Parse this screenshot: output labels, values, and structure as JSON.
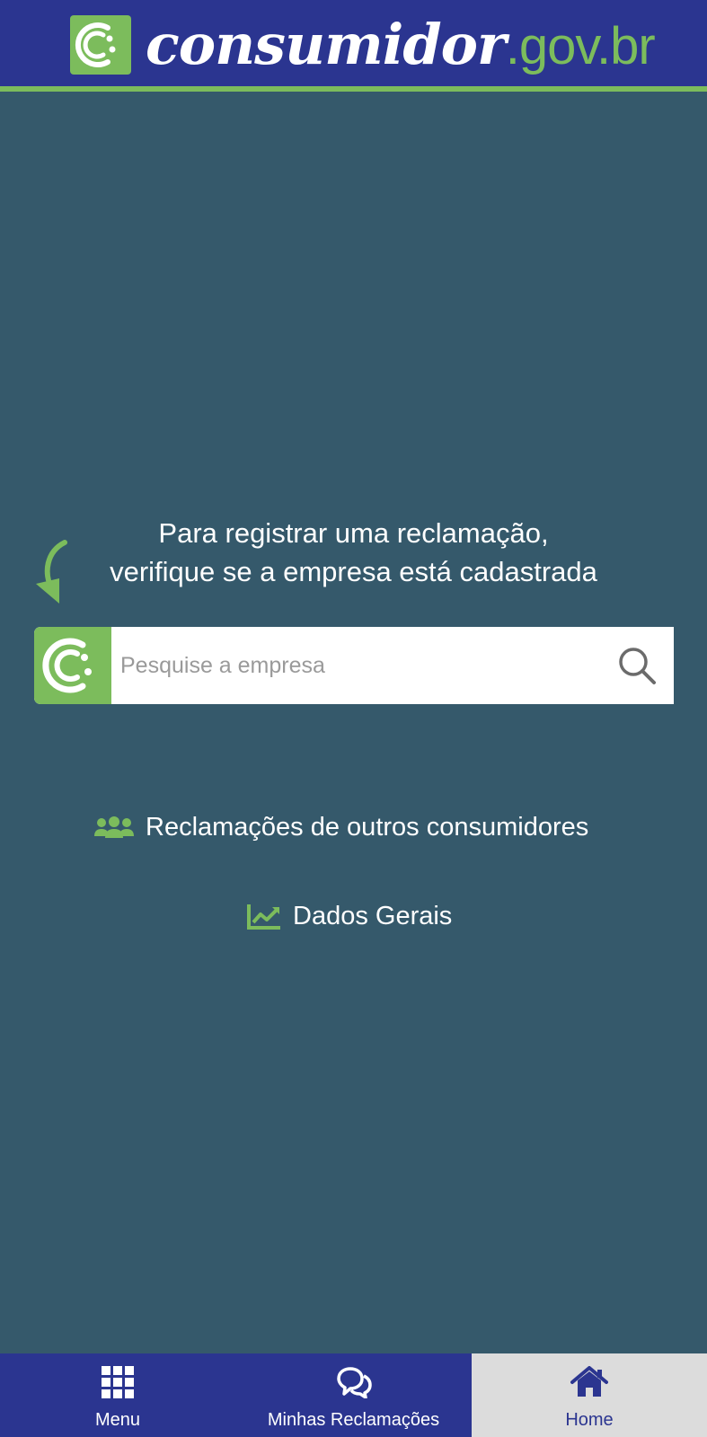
{
  "header": {
    "brand_main": "consumidor",
    "brand_suffix": ".gov.br"
  },
  "main": {
    "prompt_line1": "Para registrar uma reclamação,",
    "prompt_line2": "verifique se a empresa está cadastrada",
    "search_placeholder": "Pesquise a empresa",
    "links": {
      "others_label": "Reclamações de outros consumidores",
      "dados_label": "Dados Gerais"
    }
  },
  "bottom_nav": {
    "menu_label": "Menu",
    "reclamacoes_label": "Minhas Reclamações",
    "home_label": "Home",
    "active": "Home"
  },
  "colors": {
    "header_bg": "#2b3590",
    "accent_green": "#7cbc5c",
    "page_bg": "#35596b",
    "active_tab_bg": "#dcdcdc"
  }
}
